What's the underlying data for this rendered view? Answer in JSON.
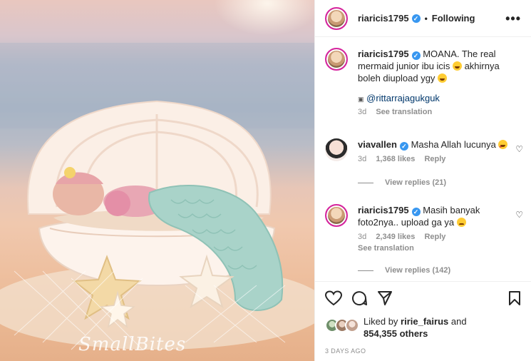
{
  "post": {
    "username": "riaricis1795",
    "follow_status": "Following",
    "more_icon": "•••",
    "photo_watermark": "SmallBites"
  },
  "caption": {
    "username": "riaricis1795",
    "text": "MOANA. The real mermaid junior ibu icis",
    "text2": "akhirnya boleh diupload ygy",
    "mention": "@rittarrajagukguk",
    "time": "3d",
    "see_translation": "See translation"
  },
  "comments": [
    {
      "username": "viavallen",
      "text": "Masha Allah lucunya",
      "time": "3d",
      "likes": "1,368 likes",
      "reply": "Reply",
      "view_replies": "View replies (21)"
    },
    {
      "username": "riaricis1795",
      "text": "Masih banyak foto2nya.. upload ga ya",
      "time": "3d",
      "likes": "2,349 likes",
      "reply": "Reply",
      "see_translation": "See translation",
      "view_replies": "View replies (142)"
    }
  ],
  "likes": {
    "prefix": "Liked by",
    "user": "ririe_fairus",
    "and": "and",
    "others": "854,355 others"
  },
  "date": "3 DAYS AGO",
  "colors": {
    "verified": "#3897f0",
    "link": "#00376b",
    "muted": "#8e8e8e",
    "story_ring": "#d6249f"
  }
}
